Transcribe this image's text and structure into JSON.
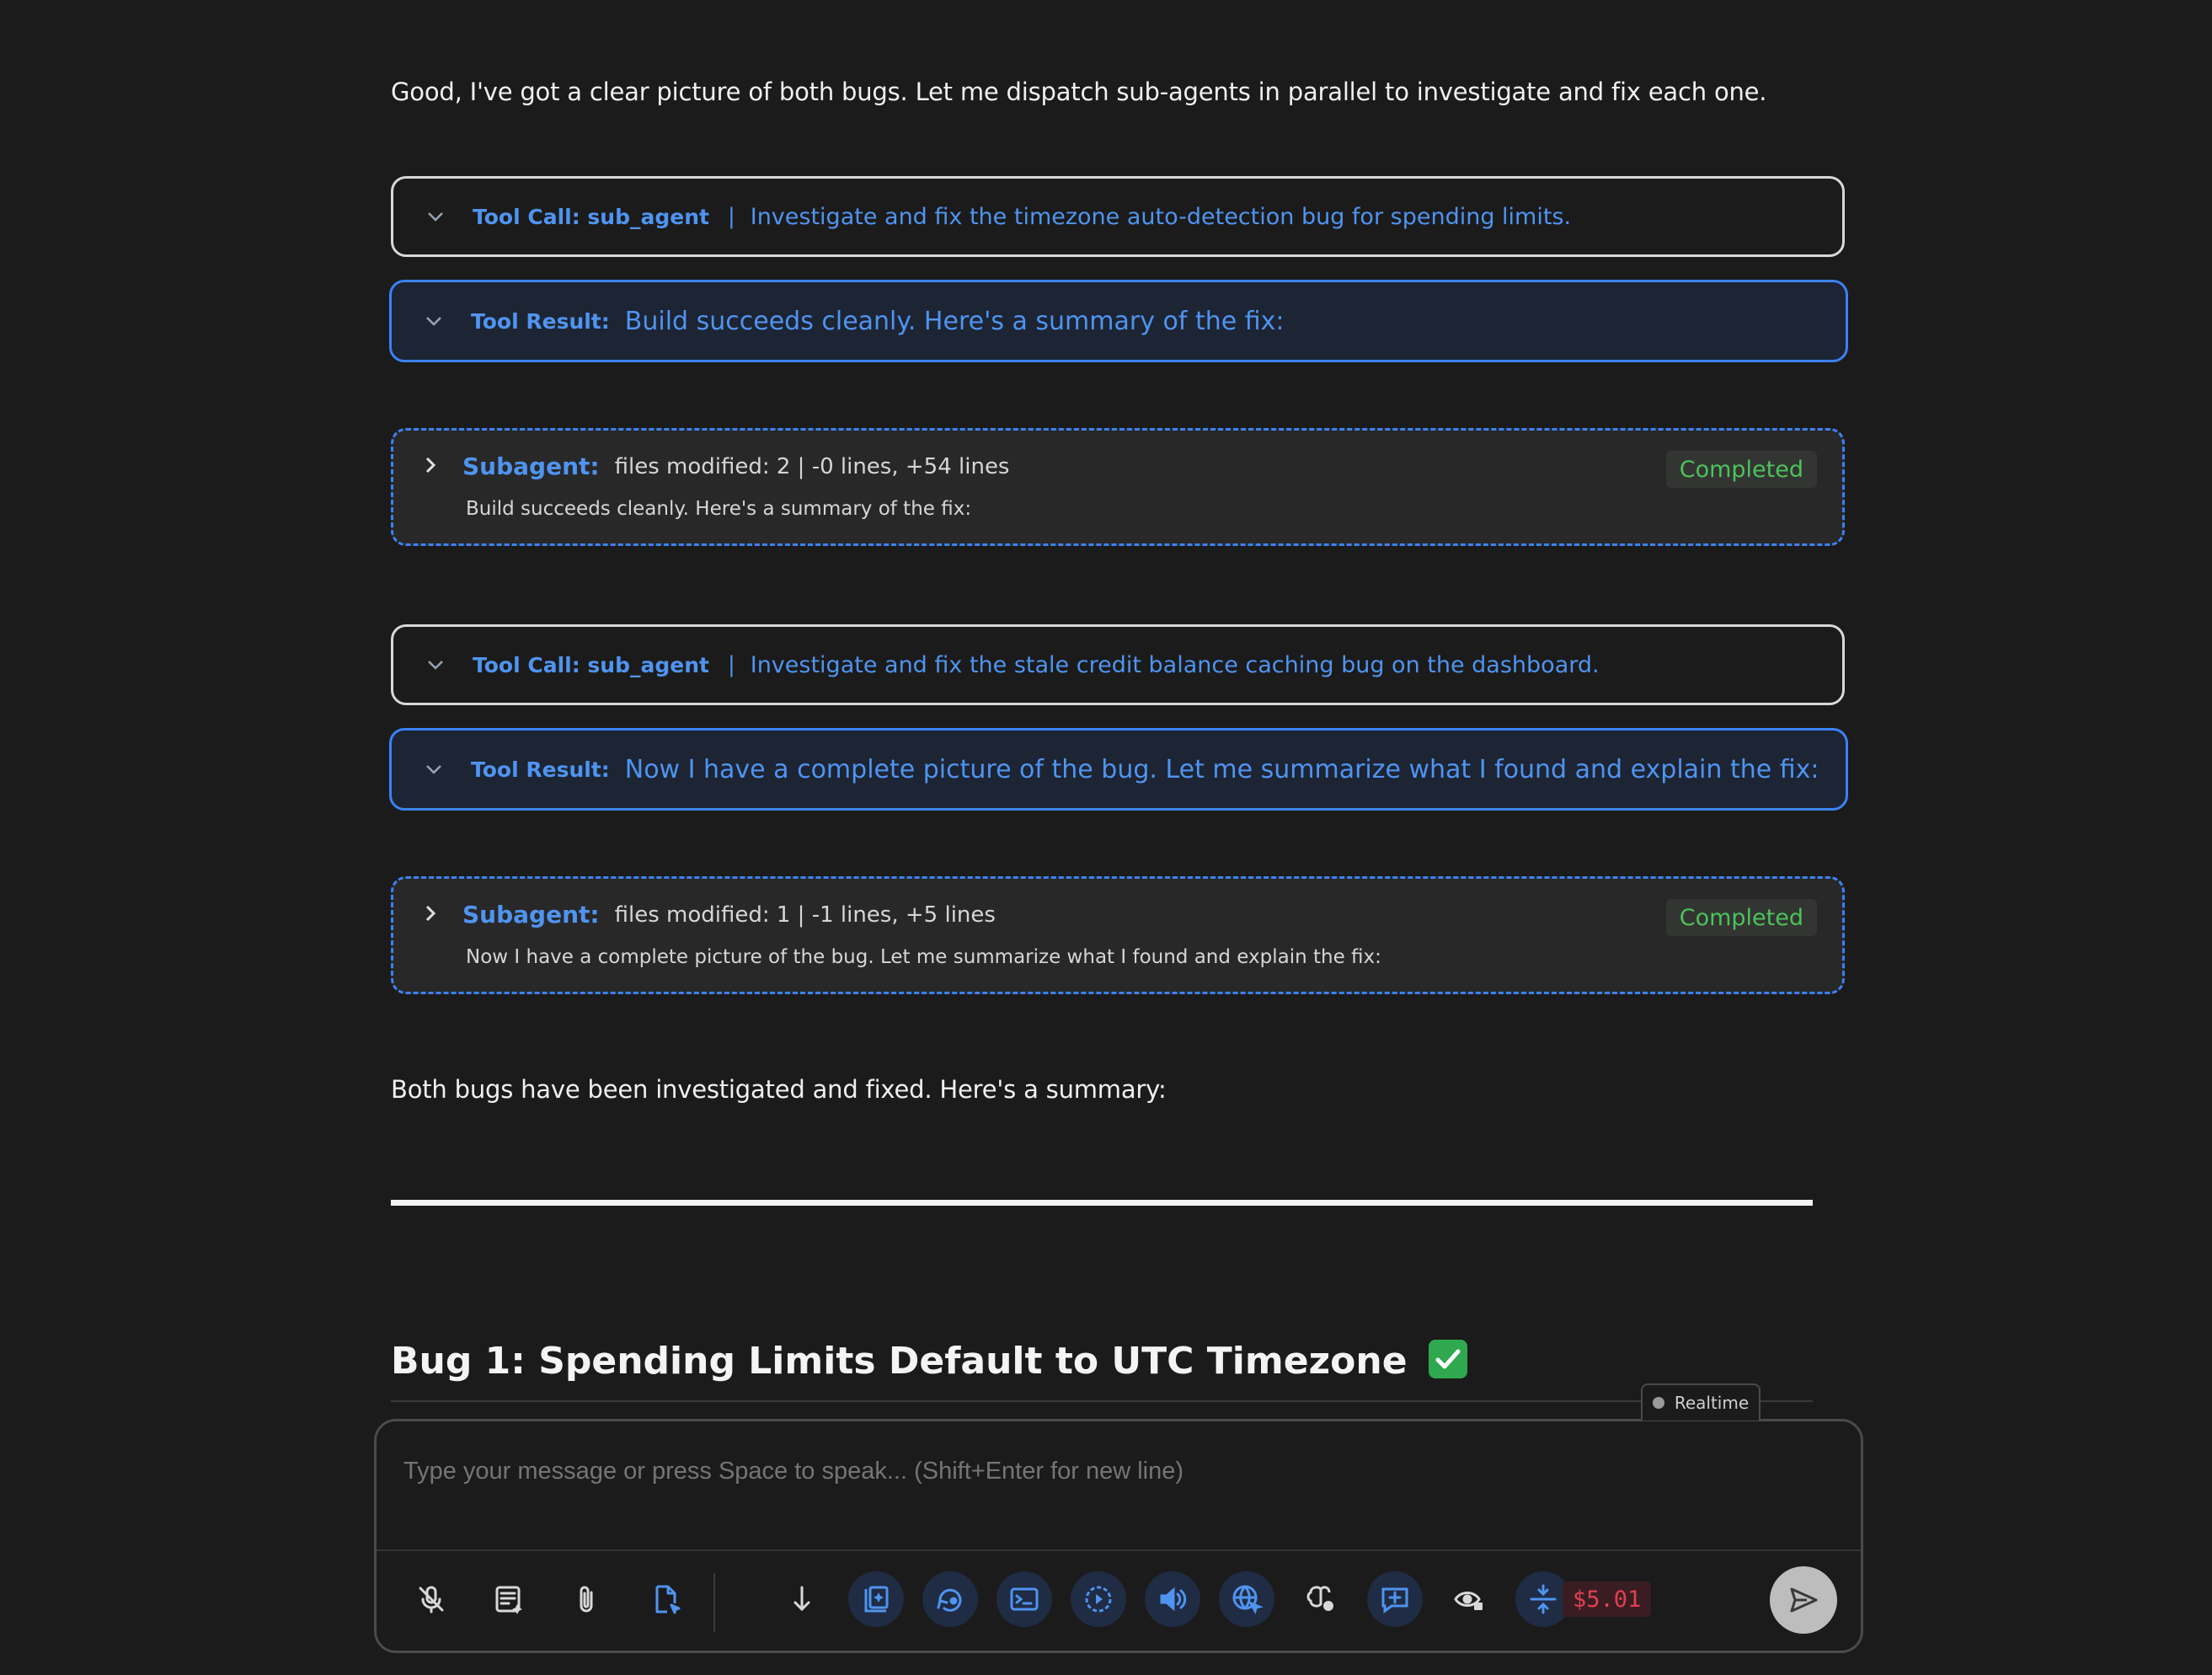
{
  "intro_text": "Good, I've got a clear picture of both bugs. Let me dispatch sub-agents in parallel to investigate and fix each one.",
  "blocks": [
    {
      "tool_call": {
        "label": "Tool Call: sub_agent",
        "separator": "|",
        "description": "Investigate and fix the timezone auto-detection bug for spending limits."
      },
      "tool_result": {
        "label": "Tool Result:",
        "text": "Build succeeds cleanly. Here's a summary of the fix:"
      },
      "subagent": {
        "label": "Subagent:",
        "files": "files modified: 2 | -0 lines, +54 lines",
        "summary": "Build succeeds cleanly. Here's a summary of the fix:",
        "status": "Completed"
      }
    },
    {
      "tool_call": {
        "label": "Tool Call: sub_agent",
        "separator": "|",
        "description": "Investigate and fix the stale credit balance caching bug on the dashboard."
      },
      "tool_result": {
        "label": "Tool Result:",
        "text": "Now I have a complete picture of the bug. Let me summarize what I found and explain the fix:"
      },
      "subagent": {
        "label": "Subagent:",
        "files": "files modified: 1 | -1 lines, +5 lines",
        "summary": "Now I have a complete picture of the bug. Let me summarize what I found and explain the fix:",
        "status": "Completed"
      }
    }
  ],
  "summary_text": "Both bugs have been investigated and fixed. Here's a summary:",
  "heading": "Bug 1: Spending Limits Default to UTC Timezone",
  "heading_emoji": "check-mark-icon",
  "realtime_tab": "Realtime",
  "composer": {
    "placeholder": "Type your message or press Space to speak... (Shift+Enter for new line)",
    "cost": "$5.01",
    "tools": [
      "mic-off-icon",
      "text-enhance-icon",
      "paperclip-icon",
      "file-select-icon",
      "scroll-down-icon",
      "image-sparkle-icon",
      "refresh-icon",
      "terminal-icon",
      "screen-record-icon",
      "speaker-icon",
      "globe-cursor-icon",
      "brain-icon",
      "message-plus-icon",
      "eye-lock-icon",
      "compress-icon"
    ],
    "send_icon": "send-icon"
  },
  "colors": {
    "background": "#1b1b1b",
    "accent_blue": "#4f94f0",
    "completed_green": "#4cc35a",
    "cost_red": "#e0404f"
  }
}
